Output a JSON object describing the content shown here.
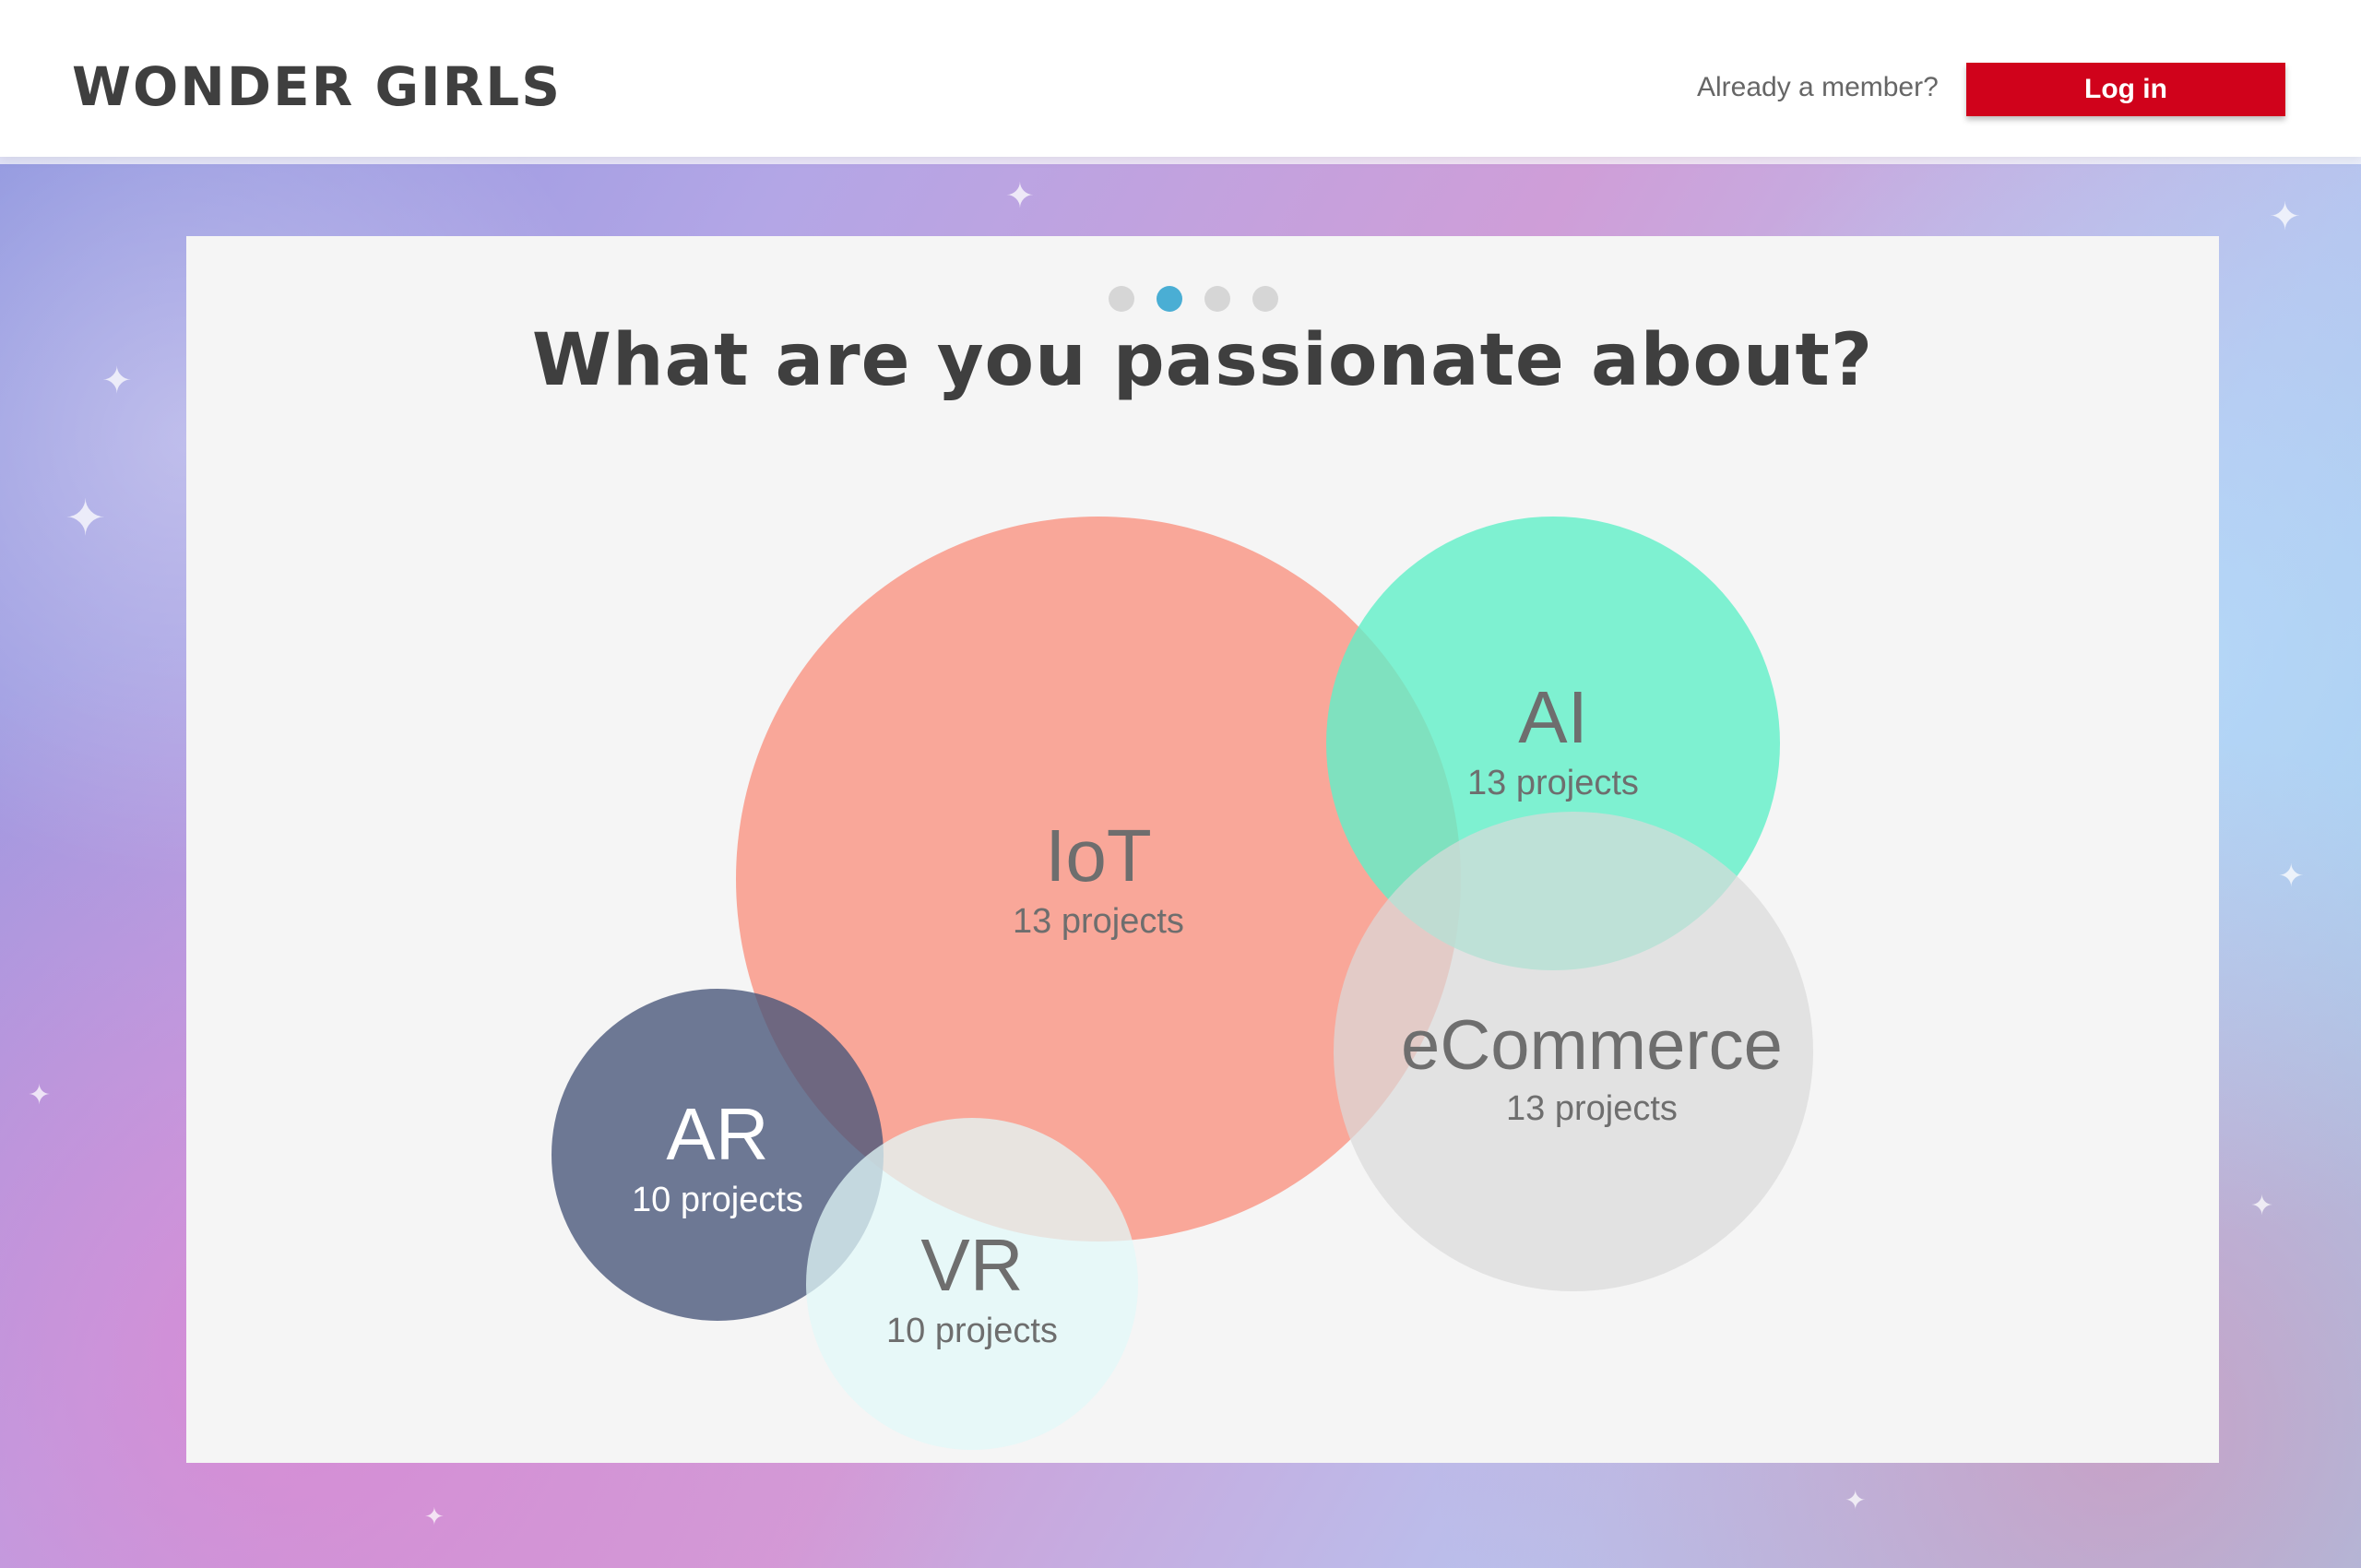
{
  "header": {
    "brand": "WONDER GIRLS",
    "member_prompt": "Already a member?",
    "login_label": "Log in",
    "login_color": "#d0021b"
  },
  "onboarding": {
    "steps_total": 4,
    "active_step": 2,
    "question": "What are you passionate about?"
  },
  "topics": [
    {
      "name": "IoT",
      "count": "13 projects",
      "color": "#f9a396"
    },
    {
      "name": "AI",
      "count": "13 projects",
      "color": "#6ff0cc"
    },
    {
      "name": "eCommerce",
      "count": "13 projects",
      "color": "#e0e0e0"
    },
    {
      "name": "AR",
      "count": "10 projects",
      "color": "#5a6a8a"
    },
    {
      "name": "VR",
      "count": "10 projects",
      "color": "#e4f8f8"
    }
  ]
}
